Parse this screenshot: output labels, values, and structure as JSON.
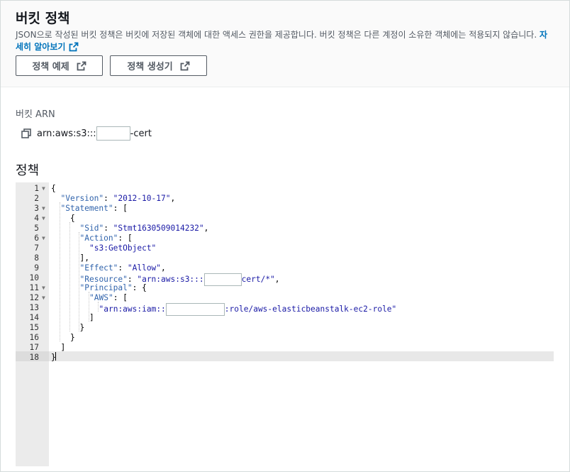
{
  "header": {
    "title": "버킷 정책",
    "description": "JSON으로 작성된 버킷 정책은 버킷에 저장된 객체에 대한 액세스 권한을 제공합니다. 버킷 정책은 다른 계정이 소유한 객체에는 적용되지 않습니다.",
    "learn_more": "자세히 알아보기",
    "buttons": {
      "examples": "정책 예제",
      "generator": "정책 생성기"
    }
  },
  "arn": {
    "label": "버킷 ARN",
    "prefix": "arn:aws:s3:::",
    "suffix": "-cert"
  },
  "policy": {
    "heading": "정책",
    "lines": [
      {
        "num": "1",
        "indent": 0,
        "fold": true,
        "tokens": [
          {
            "t": "p",
            "v": "{"
          }
        ]
      },
      {
        "num": "2",
        "indent": 1,
        "fold": false,
        "tokens": [
          {
            "t": "k",
            "v": "\"Version\""
          },
          {
            "t": "p",
            "v": ": "
          },
          {
            "t": "s",
            "v": "\"2012-10-17\""
          },
          {
            "t": "p",
            "v": ","
          }
        ]
      },
      {
        "num": "3",
        "indent": 1,
        "fold": true,
        "tokens": [
          {
            "t": "k",
            "v": "\"Statement\""
          },
          {
            "t": "p",
            "v": ": ["
          }
        ]
      },
      {
        "num": "4",
        "indent": 2,
        "fold": true,
        "tokens": [
          {
            "t": "p",
            "v": "{"
          }
        ]
      },
      {
        "num": "5",
        "indent": 3,
        "fold": false,
        "tokens": [
          {
            "t": "k",
            "v": "\"Sid\""
          },
          {
            "t": "p",
            "v": ": "
          },
          {
            "t": "s",
            "v": "\"Stmt1630509014232\""
          },
          {
            "t": "p",
            "v": ","
          }
        ]
      },
      {
        "num": "6",
        "indent": 3,
        "fold": true,
        "tokens": [
          {
            "t": "k",
            "v": "\"Action\""
          },
          {
            "t": "p",
            "v": ": ["
          }
        ]
      },
      {
        "num": "7",
        "indent": 4,
        "fold": false,
        "tokens": [
          {
            "t": "s",
            "v": "\"s3:GetObject\""
          }
        ]
      },
      {
        "num": "8",
        "indent": 3,
        "fold": false,
        "tokens": [
          {
            "t": "p",
            "v": "],"
          }
        ]
      },
      {
        "num": "9",
        "indent": 3,
        "fold": false,
        "tokens": [
          {
            "t": "k",
            "v": "\"Effect\""
          },
          {
            "t": "p",
            "v": ": "
          },
          {
            "t": "s",
            "v": "\"Allow\""
          },
          {
            "t": "p",
            "v": ","
          }
        ]
      },
      {
        "num": "10",
        "indent": 3,
        "fold": false,
        "tokens": [
          {
            "t": "k",
            "v": "\"Resource\""
          },
          {
            "t": "p",
            "v": ": "
          },
          {
            "t": "s",
            "v": "\"arn:aws:s3:::"
          },
          {
            "t": "r",
            "v": "r1"
          },
          {
            "t": "s",
            "v": "cert/*\""
          },
          {
            "t": "p",
            "v": ","
          }
        ]
      },
      {
        "num": "11",
        "indent": 3,
        "fold": true,
        "tokens": [
          {
            "t": "k",
            "v": "\"Principal\""
          },
          {
            "t": "p",
            "v": ": {"
          }
        ]
      },
      {
        "num": "12",
        "indent": 4,
        "fold": true,
        "tokens": [
          {
            "t": "k",
            "v": "\"AWS\""
          },
          {
            "t": "p",
            "v": ": ["
          }
        ]
      },
      {
        "num": "13",
        "indent": 5,
        "fold": false,
        "tokens": [
          {
            "t": "s",
            "v": "\"arn:aws:iam::"
          },
          {
            "t": "r",
            "v": "r2"
          },
          {
            "t": "s",
            "v": ":role/aws-elasticbeanstalk-ec2-role\""
          }
        ]
      },
      {
        "num": "14",
        "indent": 4,
        "fold": false,
        "tokens": [
          {
            "t": "p",
            "v": "]"
          }
        ]
      },
      {
        "num": "15",
        "indent": 3,
        "fold": false,
        "tokens": [
          {
            "t": "p",
            "v": "}"
          }
        ]
      },
      {
        "num": "16",
        "indent": 2,
        "fold": false,
        "tokens": [
          {
            "t": "p",
            "v": "}"
          }
        ]
      },
      {
        "num": "17",
        "indent": 1,
        "fold": false,
        "tokens": [
          {
            "t": "p",
            "v": "]"
          }
        ]
      },
      {
        "num": "18",
        "indent": 0,
        "fold": false,
        "tokens": [
          {
            "t": "p",
            "v": "}"
          }
        ]
      }
    ]
  },
  "colors": {
    "link": "#0073bb",
    "key": "#3164ac",
    "string": "#1a1aa6",
    "header_bg": "#fafafa",
    "gutter_bg": "#ebebeb"
  },
  "icons": {
    "external": "external-link-icon",
    "copy": "copy-icon",
    "fold": "fold-arrow-icon"
  }
}
